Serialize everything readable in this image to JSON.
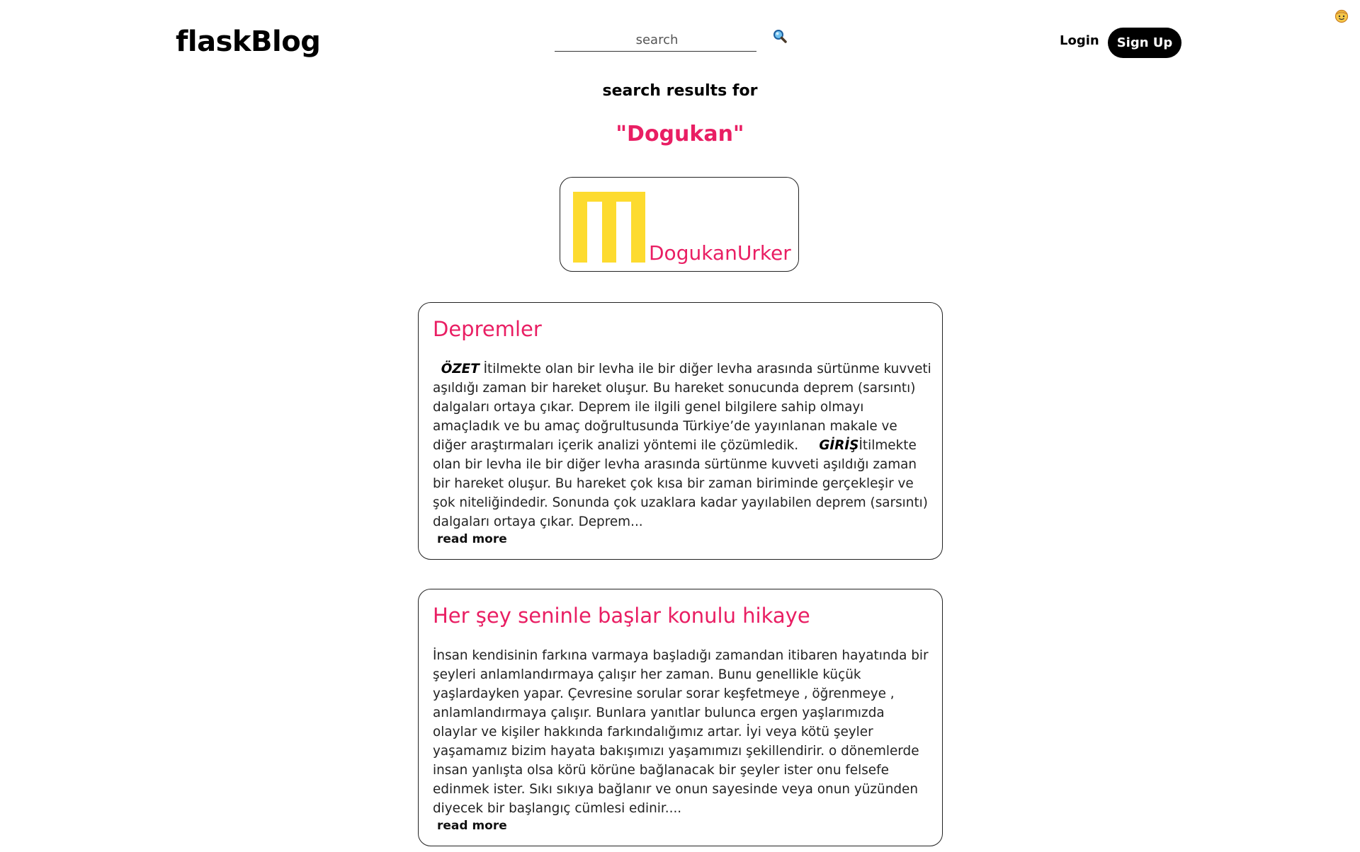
{
  "header": {
    "brand": "flaskBlog",
    "search": {
      "placeholder": "search",
      "value": ""
    },
    "search_icon": "magnifier-icon",
    "login_label": "Login",
    "signup_label": "Sign Up",
    "corner_icon": "smiley-extension-icon"
  },
  "results": {
    "heading": "search results for",
    "query": "\"Dogukan\""
  },
  "user": {
    "name": "DogukanUrker",
    "logo_icon": "yellow-logo-icon",
    "logo_color": "#FDDB2F"
  },
  "posts": [
    {
      "title": "Depremler",
      "body_parts": [
        {
          "text": "  "
        },
        {
          "text": "ÖZET",
          "highlight": true
        },
        {
          "text": " İtilmekte olan bir levha ile bir diğer levha arasında sürtünme kuvveti aşıldığı zaman bir hareket oluşur. Bu hareket sonucunda deprem (sarsıntı) dalgaları ortaya çıkar. Deprem ile ilgili genel bilgilere sahip olmayı amaçladık ve bu amaç doğrultusunda Türkiye’de yayınlanan makale ve diğer araştırmaları içerik analizi yöntemi ile çözümledik.     "
        },
        {
          "text": "GİRİŞ",
          "highlight": true
        },
        {
          "text": "İtilmekte olan bir levha ile bir diğer levha arasında sürtünme kuvveti aşıldığı zaman bir hareket oluşur. Bu hareket çok kısa bir zaman biriminde gerçekleşir ve şok niteliğindedir. Sonunda çok uzaklara kadar yayılabilen deprem (sarsıntı) dalgaları ortaya çıkar. Deprem..."
        }
      ],
      "read_more": "read more"
    },
    {
      "title": "Her şey seninle başlar konulu hikaye",
      "body_parts": [
        {
          "text": "İnsan kendisinin farkına varmaya başladığı zamandan itibaren hayatında bir şeyleri anlamlandırmaya çalışır her zaman. Bunu genellikle küçük yaşlardayken yapar. Çevresine sorular sorar keşfetmeye , öğrenmeye , anlamlandırmaya çalışır. Bunlara yanıtlar bulunca ergen yaşlarımızda olaylar ve kişiler hakkında farkındalığımız artar. İyi veya kötü şeyler yaşamamız bizim hayata bakışımızı yaşamımızı şekillendirir. o dönemlerde insan yanlışta olsa körü körüne bağlanacak bir şeyler ister onu felsefe edinmek ister. Sıkı sıkıya bağlanır ve onun sayesinde veya onun yüzünden diyecek bir başlangıç cümlesi edinir...."
        }
      ],
      "read_more": "read more"
    }
  ],
  "colors": {
    "accent": "#E91E63",
    "primary_button": "#000000",
    "logo_yellow": "#FDDB2F"
  }
}
